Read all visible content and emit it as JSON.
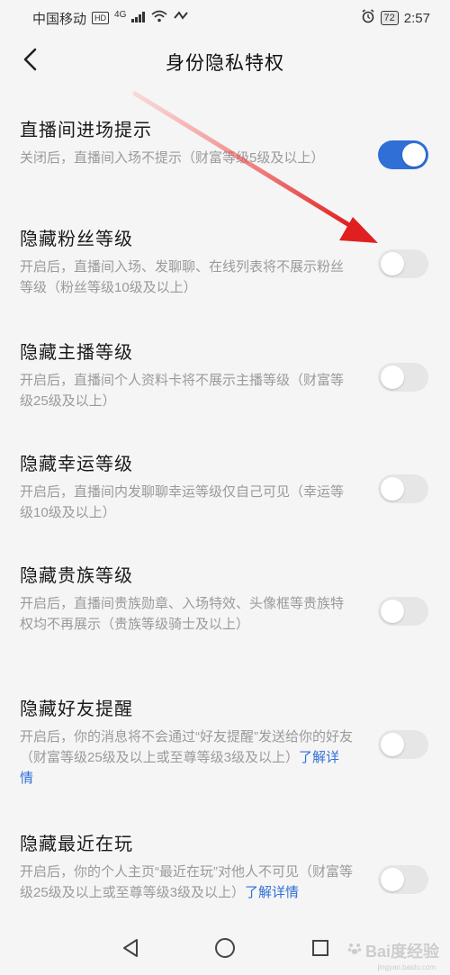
{
  "status_bar": {
    "carrier": "中国移动",
    "hd": "HD",
    "network": "4G",
    "battery": "72",
    "time": "2:57"
  },
  "header": {
    "title": "身份隐私特权"
  },
  "settings": [
    {
      "title": "直播间进场提示",
      "desc": "关闭后，直播间入场不提示（财富等级5级及以上）",
      "enabled": true
    },
    {
      "title": "隐藏粉丝等级",
      "desc": "开启后，直播间入场、发聊聊、在线列表将不展示粉丝等级（粉丝等级10级及以上）",
      "enabled": false
    },
    {
      "title": "隐藏主播等级",
      "desc": "开启后，直播间个人资料卡将不展示主播等级（财富等级25级及以上）",
      "enabled": false
    },
    {
      "title": "隐藏幸运等级",
      "desc": "开启后，直播间内发聊聊幸运等级仅自己可见（幸运等级10级及以上）",
      "enabled": false
    },
    {
      "title": "隐藏贵族等级",
      "desc": "开启后，直播间贵族勋章、入场特效、头像框等贵族特权均不再展示（贵族等级骑士及以上）",
      "enabled": false
    },
    {
      "title": "隐藏好友提醒",
      "desc": "开启后，你的消息将不会通过“好友提醒”发送给你的好友（财富等级25级及以上或至尊等级3级及以上）",
      "link": "了解详情",
      "enabled": false
    },
    {
      "title": "隐藏最近在玩",
      "desc": "开启后，你的个人主页“最近在玩”对他人不可见（财富等级25级及以上或至尊等级3级及以上）",
      "link": "了解详情",
      "enabled": false
    }
  ],
  "watermark": {
    "main": "Bai度经验",
    "sub": "jingyan.baidu.com"
  },
  "colors": {
    "accent": "#2f6fd6",
    "annotation_arrow": "#e02020"
  }
}
